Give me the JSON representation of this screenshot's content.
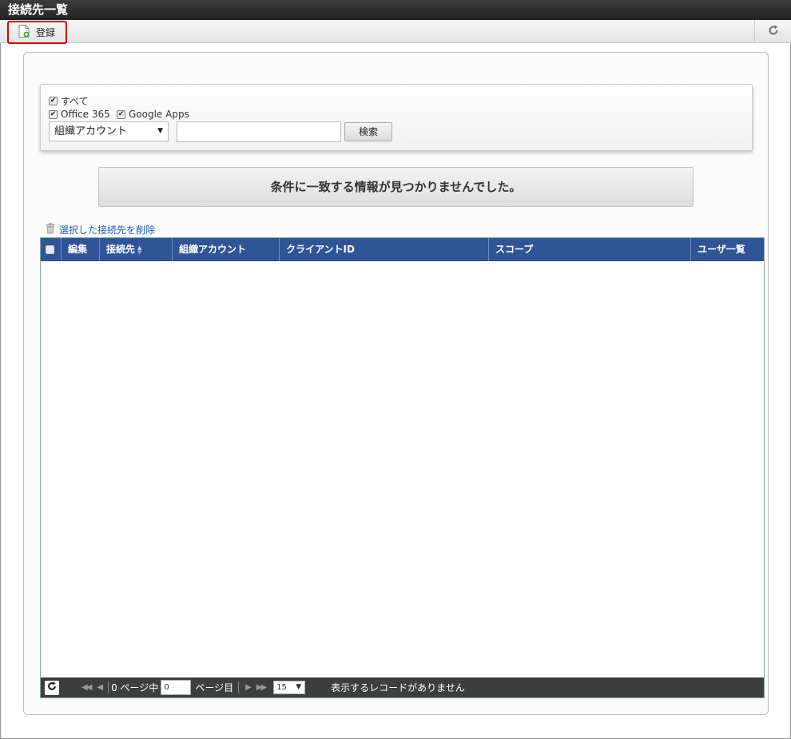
{
  "window": {
    "title": "接続先一覧"
  },
  "toolbar": {
    "register_label": "登録"
  },
  "filters": {
    "all_label": "すべて",
    "office365_label": "Office 365",
    "google_apps_label": "Google Apps",
    "search_field_select": "組織アカウント",
    "search_button": "検索"
  },
  "message": "条件に一致する情報が見つかりませんでした。",
  "delete_selected_label": "選択した接続先を削除",
  "grid": {
    "columns": [
      "編集",
      "接続先",
      "組織アカウント",
      "クライアントID",
      "スコープ",
      "ユーザ一覧"
    ]
  },
  "pager": {
    "page_count_text": "0 ページ中",
    "page_input_value": "0",
    "page_suffix": "ページ目",
    "rows_per_page": "15",
    "status": "表示するレコードがありません"
  },
  "colors": {
    "title_bar": "#2a2a2a",
    "grid_header": "#2f5597",
    "pager_bg": "#3e3e3e",
    "highlight_border": "#dd0000",
    "link": "#1a5fb4"
  }
}
